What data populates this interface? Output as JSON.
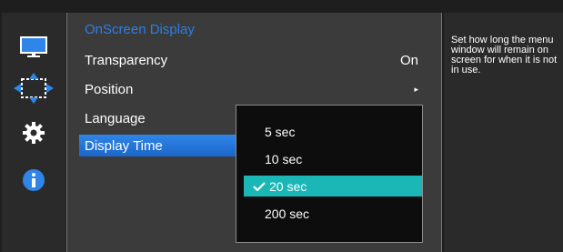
{
  "menu": {
    "title": "OnScreen Display",
    "items": [
      {
        "label": "Transparency",
        "value": "On"
      },
      {
        "label": "Position",
        "value": "▸"
      },
      {
        "label": "Language",
        "value": ""
      },
      {
        "label": "Display Time",
        "value": ""
      }
    ],
    "selected_item": "Display Time"
  },
  "dropdown": {
    "options": [
      "5 sec",
      "10 sec",
      "20 sec",
      "200 sec"
    ],
    "selected": "20 sec"
  },
  "help": {
    "text": "Set how long the menu window will remain on screen for when it is not in use."
  },
  "side_icons": [
    "monitor-icon",
    "move-arrows-icon",
    "gear-icon",
    "info-icon"
  ],
  "colors": {
    "title_blue": "#2b7fe6",
    "selected_row": "#1b66c9",
    "selected_option": "#1bb7b7",
    "panel_bg": "#3b3b3b",
    "frame_bg": "#1e1e1e"
  }
}
